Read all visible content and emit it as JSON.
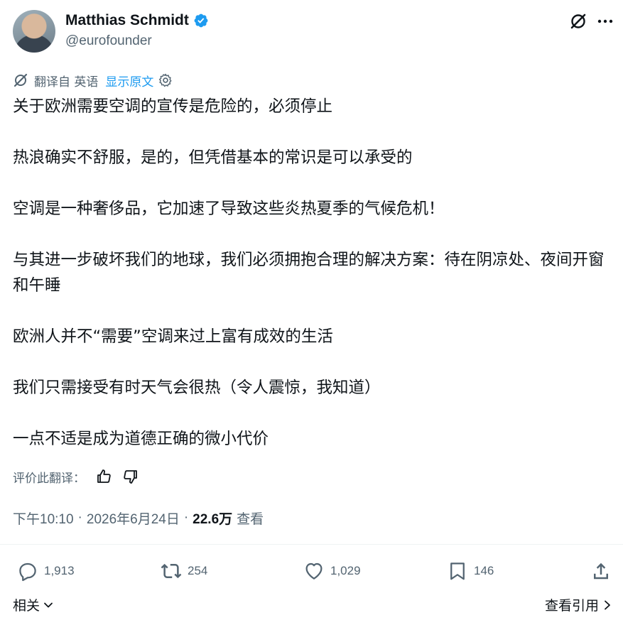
{
  "author": {
    "name": "Matthias Schmidt",
    "handle": "@eurofounder"
  },
  "translation": {
    "label": "翻译自 英语",
    "show_original": "显示原文"
  },
  "paragraphs": [
    "关于欧洲需要空调的宣传是危险的，必须停止",
    "热浪确实不舒服，是的，但凭借基本的常识是可以承受的",
    "空调是一种奢侈品，它加速了导致这些炎热夏季的气候危机！",
    "与其进一步破坏我们的地球，我们必须拥抱合理的解决方案：待在阴凉处、夜间开窗和午睡",
    "欧洲人并不“需要”空调来过上富有成效的生活",
    "我们只需接受有时天气会很热（令人震惊，我知道）",
    "一点不适是成为道德正确的微小代价"
  ],
  "rate_translation": "评价此翻译：",
  "meta": {
    "time": "下午10:10",
    "dot": "·",
    "date": "2026年6月24日",
    "views": "22.6万",
    "views_label": "查看"
  },
  "actions": {
    "replies": "1,913",
    "reposts": "254",
    "likes": "1,029",
    "bookmarks": "146"
  },
  "footer": {
    "related": "相关",
    "quotes": "查看引用"
  },
  "colors": {
    "accent": "#1d9bf0",
    "text": "#0f1419",
    "muted": "#536471"
  }
}
